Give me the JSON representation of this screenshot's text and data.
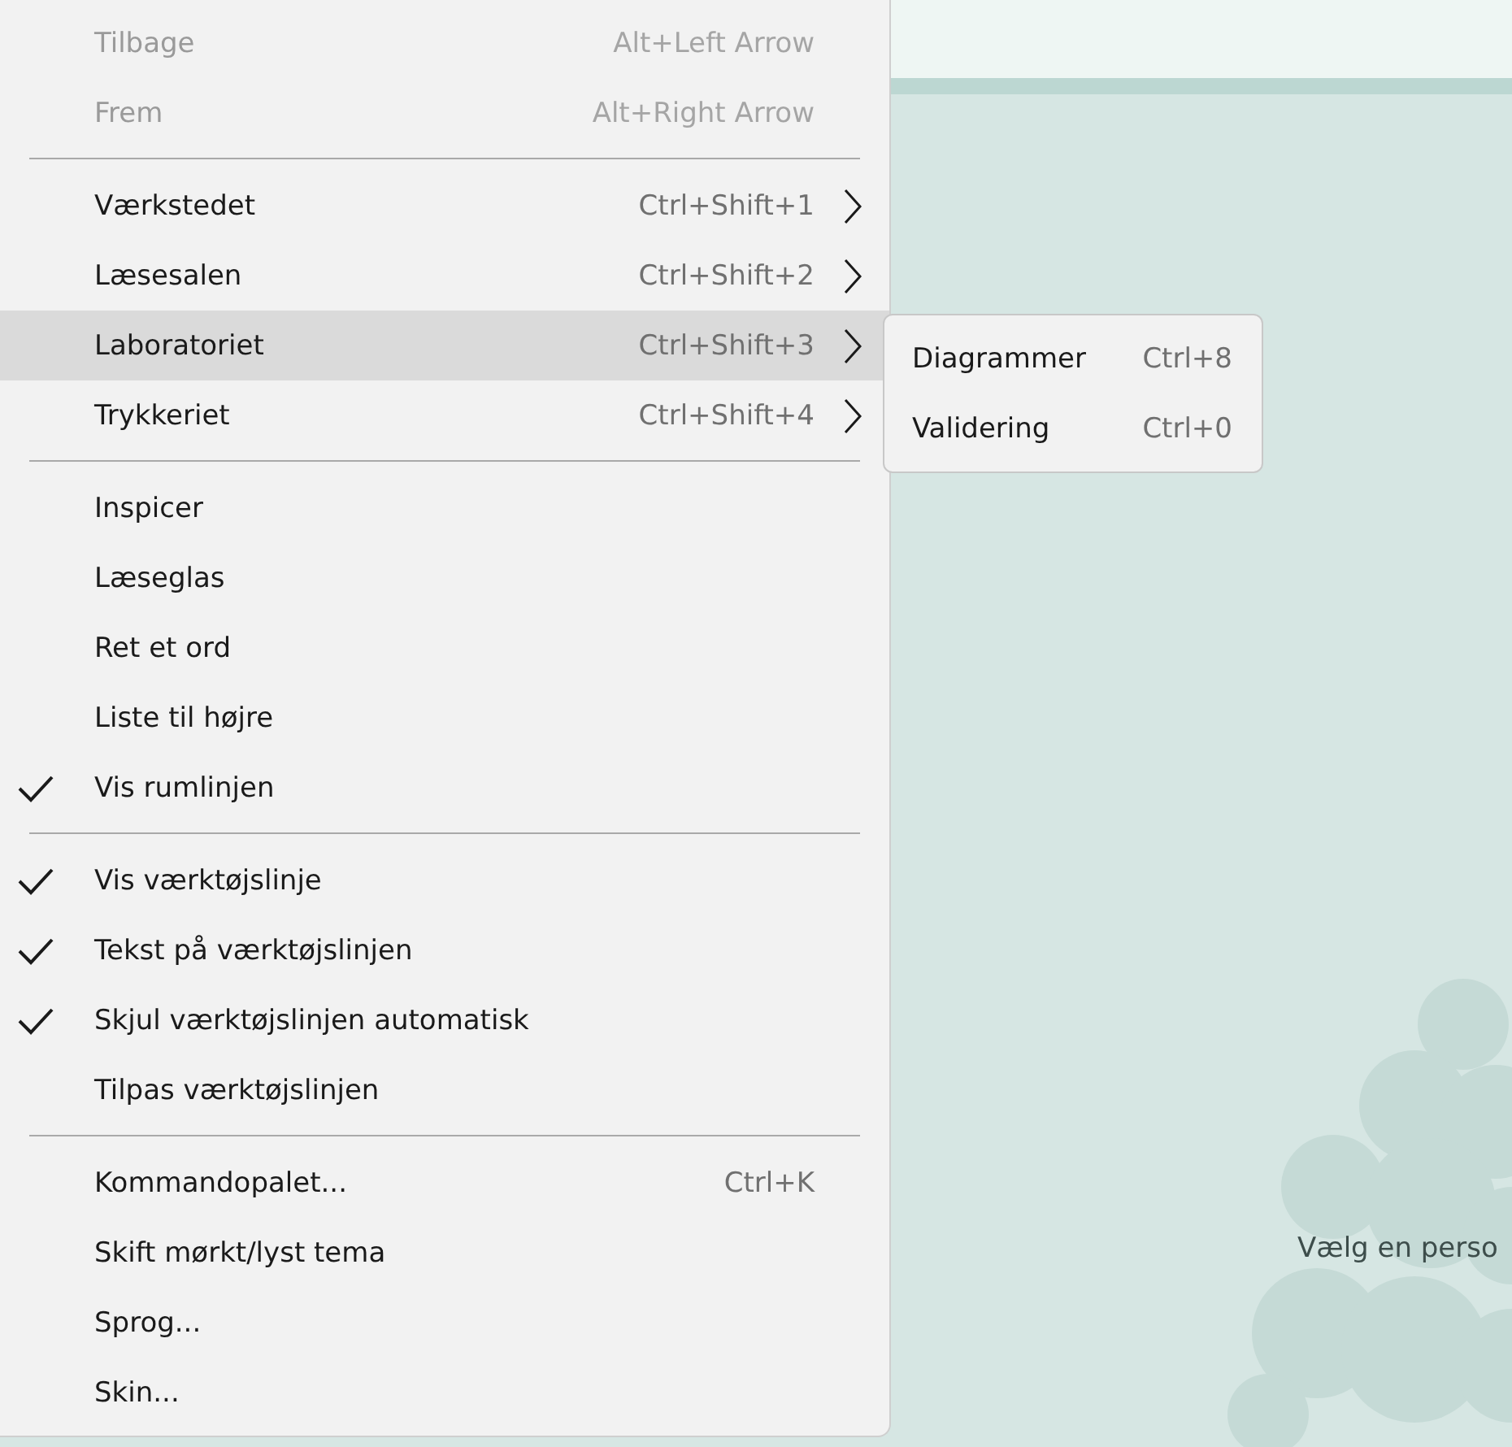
{
  "background": {
    "message": "Vælg en perso"
  },
  "menu": {
    "items": [
      {
        "kind": "item",
        "label": "Tilbage",
        "shortcut": "Alt+Left Arrow",
        "disabled": true,
        "checked": false,
        "submenu": false,
        "selected": false
      },
      {
        "kind": "item",
        "label": "Frem",
        "shortcut": "Alt+Right Arrow",
        "disabled": true,
        "checked": false,
        "submenu": false,
        "selected": false
      },
      {
        "kind": "separator"
      },
      {
        "kind": "item",
        "label": "Værkstedet",
        "shortcut": "Ctrl+Shift+1",
        "disabled": false,
        "checked": false,
        "submenu": true,
        "selected": false
      },
      {
        "kind": "item",
        "label": "Læsesalen",
        "shortcut": "Ctrl+Shift+2",
        "disabled": false,
        "checked": false,
        "submenu": true,
        "selected": false
      },
      {
        "kind": "item",
        "label": "Laboratoriet",
        "shortcut": "Ctrl+Shift+3",
        "disabled": false,
        "checked": false,
        "submenu": true,
        "selected": true
      },
      {
        "kind": "item",
        "label": "Trykkeriet",
        "shortcut": "Ctrl+Shift+4",
        "disabled": false,
        "checked": false,
        "submenu": true,
        "selected": false
      },
      {
        "kind": "separator"
      },
      {
        "kind": "item",
        "label": "Inspicer",
        "disabled": false,
        "checked": false,
        "submenu": false,
        "selected": false
      },
      {
        "kind": "item",
        "label": "Læseglas",
        "disabled": false,
        "checked": false,
        "submenu": false,
        "selected": false
      },
      {
        "kind": "item",
        "label": "Ret et ord",
        "disabled": false,
        "checked": false,
        "submenu": false,
        "selected": false
      },
      {
        "kind": "item",
        "label": "Liste til højre",
        "disabled": false,
        "checked": false,
        "submenu": false,
        "selected": false
      },
      {
        "kind": "item",
        "label": "Vis rumlinjen",
        "disabled": false,
        "checked": true,
        "submenu": false,
        "selected": false
      },
      {
        "kind": "separator"
      },
      {
        "kind": "item",
        "label": "Vis værktøjslinje",
        "disabled": false,
        "checked": true,
        "submenu": false,
        "selected": false
      },
      {
        "kind": "item",
        "label": "Tekst på værktøjslinjen",
        "disabled": false,
        "checked": true,
        "submenu": false,
        "selected": false
      },
      {
        "kind": "item",
        "label": "Skjul værktøjslinjen automatisk",
        "disabled": false,
        "checked": true,
        "submenu": false,
        "selected": false
      },
      {
        "kind": "item",
        "label": "Tilpas værktøjslinjen",
        "disabled": false,
        "checked": false,
        "submenu": false,
        "selected": false
      },
      {
        "kind": "separator"
      },
      {
        "kind": "item",
        "label": "Kommandopalet...",
        "shortcut": "Ctrl+K",
        "disabled": false,
        "checked": false,
        "submenu": false,
        "selected": false
      },
      {
        "kind": "item",
        "label": "Skift mørkt/lyst tema",
        "disabled": false,
        "checked": false,
        "submenu": false,
        "selected": false
      },
      {
        "kind": "item",
        "label": "Sprog...",
        "disabled": false,
        "checked": false,
        "submenu": false,
        "selected": false
      },
      {
        "kind": "item",
        "label": "Skin...",
        "disabled": false,
        "checked": false,
        "submenu": false,
        "selected": false
      }
    ]
  },
  "submenu": {
    "items": [
      {
        "label": "Diagrammer",
        "shortcut": "Ctrl+8"
      },
      {
        "label": "Validering",
        "shortcut": "Ctrl+0"
      }
    ]
  }
}
